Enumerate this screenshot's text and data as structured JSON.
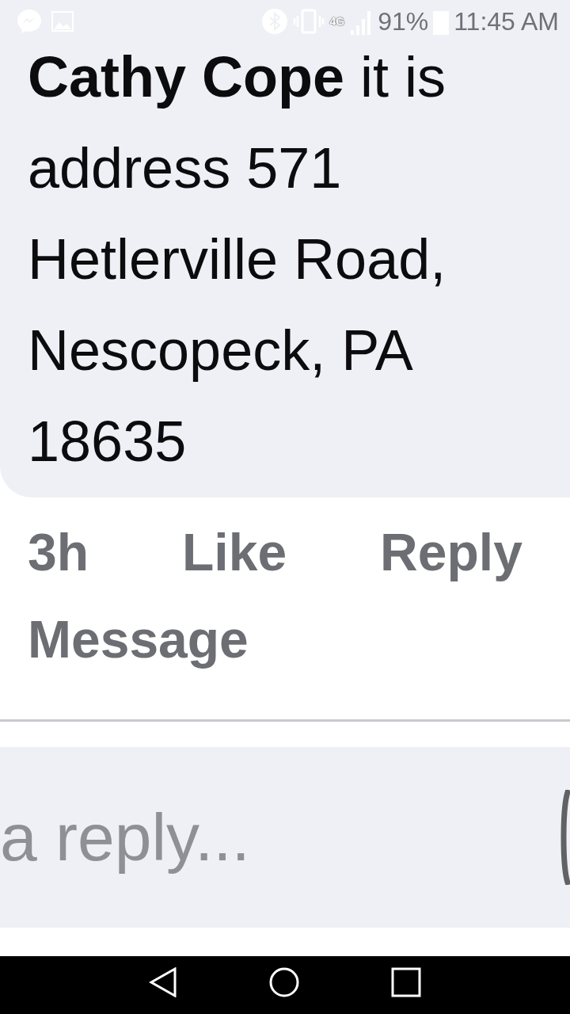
{
  "status_bar": {
    "battery": "91%",
    "time": "11:45 AM",
    "network": "4G"
  },
  "comment": {
    "author": "Cathy Cope",
    "lines": [
      "it is",
      "address 571",
      "Hetlerville Road,",
      "Nescopeck, PA",
      "18635"
    ]
  },
  "actions": [
    "3h",
    "Like",
    "Reply",
    "Message"
  ],
  "reply_field": {
    "placeholder": "a reply..."
  }
}
